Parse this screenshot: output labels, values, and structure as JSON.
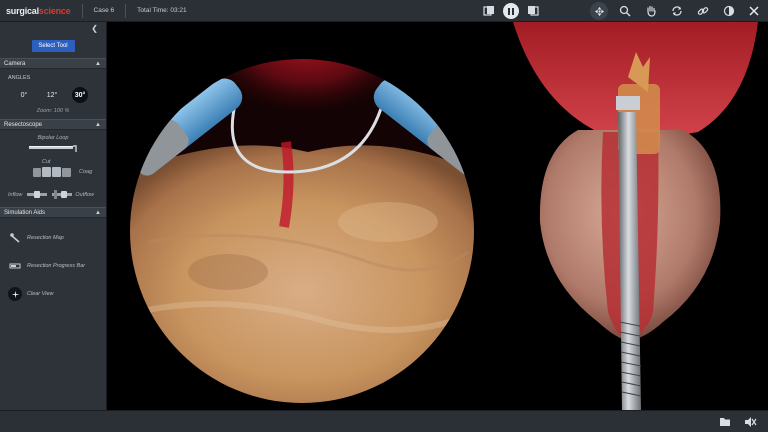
{
  "brand": {
    "part1": "surgical",
    "part2": "science"
  },
  "header": {
    "case_label": "Case 6",
    "time_label": "Total Time: 03:21",
    "icons": [
      "window-left-icon",
      "pause-icon",
      "window-right-icon",
      "navigation-icon",
      "search-icon",
      "hand-icon",
      "rotate-icon",
      "link-icon",
      "contrast-icon",
      "close-icon"
    ]
  },
  "panel": {
    "collapse_icon": "chevron-left-icon",
    "select_tool_label": "Select Tool",
    "camera": {
      "title": "Camera",
      "angles_title": "ANGLES",
      "angles": [
        "0°",
        "12°",
        "30°"
      ],
      "active_angle": "30°",
      "zoom": "Zoom: 100 %"
    },
    "resectoscope": {
      "title": "Resectoscope",
      "loop_label": "Bipolar Loop",
      "cut_label": "Cut",
      "coag_label": "Coag",
      "inflow_label": "Inflow",
      "outflow_label": "Outflow"
    },
    "simulation_aids": {
      "title": "Simulation Aids",
      "items": [
        {
          "label": "Resection Map",
          "icon": "map-icon"
        },
        {
          "label": "Resection Progress Bar",
          "icon": "progress-bar-icon"
        },
        {
          "label": "Clear View",
          "icon": "clear-view-icon"
        }
      ]
    }
  },
  "footer": {
    "icons": [
      "folder-icon",
      "mute-icon"
    ]
  },
  "colors": {
    "accent": "#2d5fbf",
    "brand_red": "#e0362c",
    "topbar": "#2b2f36",
    "panel": "#2e3339"
  }
}
